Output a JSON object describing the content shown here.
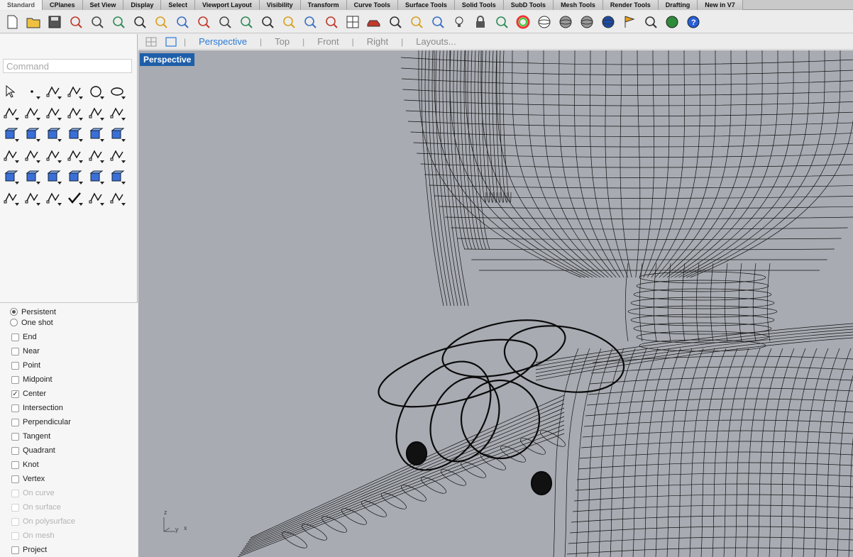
{
  "tabs": [
    "Standard",
    "CPlanes",
    "Set View",
    "Display",
    "Select",
    "Viewport Layout",
    "Visibility",
    "Transform",
    "Curve Tools",
    "Surface Tools",
    "Solid Tools",
    "SubD Tools",
    "Mesh Tools",
    "Render Tools",
    "Drafting",
    "New in V7"
  ],
  "active_tab": "Standard",
  "command": {
    "placeholder": "Command",
    "value": ""
  },
  "viewport_tabs": [
    "Perspective",
    "Top",
    "Front",
    "Right",
    "Layouts..."
  ],
  "active_viewport": "Perspective",
  "viewport_label": "Perspective",
  "snap_mode": {
    "persistent": "Persistent",
    "one_shot": "One shot",
    "selected": "persistent"
  },
  "osnaps": [
    {
      "label": "End",
      "checked": false,
      "enabled": true
    },
    {
      "label": "Near",
      "checked": false,
      "enabled": true
    },
    {
      "label": "Point",
      "checked": false,
      "enabled": true
    },
    {
      "label": "Midpoint",
      "checked": false,
      "enabled": true
    },
    {
      "label": "Center",
      "checked": true,
      "enabled": true
    },
    {
      "label": "Intersection",
      "checked": false,
      "enabled": true
    },
    {
      "label": "Perpendicular",
      "checked": false,
      "enabled": true
    },
    {
      "label": "Tangent",
      "checked": false,
      "enabled": true
    },
    {
      "label": "Quadrant",
      "checked": false,
      "enabled": true
    },
    {
      "label": "Knot",
      "checked": false,
      "enabled": true
    },
    {
      "label": "Vertex",
      "checked": false,
      "enabled": true
    },
    {
      "label": "On curve",
      "checked": false,
      "enabled": false
    },
    {
      "label": "On surface",
      "checked": false,
      "enabled": false
    },
    {
      "label": "On polysurface",
      "checked": false,
      "enabled": false
    },
    {
      "label": "On mesh",
      "checked": false,
      "enabled": false
    },
    {
      "label": "Project",
      "checked": false,
      "enabled": true
    }
  ],
  "axis_labels": {
    "z": "z",
    "y": "y",
    "x": "x"
  },
  "toolbar_icons": [
    "new-file-icon",
    "open-folder-icon",
    "save-icon",
    "print-icon",
    "import-icon",
    "cut-icon",
    "copy-icon",
    "paste-icon",
    "undo-icon",
    "pan-hand-icon",
    "rotate-view-icon",
    "zoom-window-icon",
    "zoom-extents-icon",
    "zoom-selected-icon",
    "zoom-dynamic-icon",
    "undo-view-icon",
    "four-viewports-icon",
    "car-icon",
    "grid-plane-icon",
    "cplane-icon",
    "select-points-icon",
    "light-bulb-icon",
    "lock-icon",
    "layer-icon",
    "color-wheel-icon",
    "wireframe-sphere-icon",
    "shaded-sphere-icon",
    "rendered-sphere-icon",
    "material-sphere-icon",
    "flag-icon",
    "dimension-icon",
    "globe-icon",
    "help-icon"
  ],
  "left_tools": [
    "select-arrow-icon",
    "point-icon",
    "polyline-icon",
    "curve-icon",
    "circle-icon",
    "ellipse-icon",
    "arc-icon",
    "rectangle-icon",
    "polygon-icon",
    "fillet-curve-icon",
    "surface-from-points-icon",
    "extrude-surface-icon",
    "box-icon",
    "sphere-icon",
    "cylinder-icon",
    "plane-surface-icon",
    "solid-tools-icon",
    "explode-icon",
    "extend-icon",
    "offset-icon",
    "boolean-union-icon",
    "boolean-diff-icon",
    "fillet-edge-icon",
    "blend-icon",
    "text-icon",
    "scale-icon",
    "array-icon",
    "edit-points-icon",
    "solid-edit-icon",
    "dimension-tool-icon",
    "grid-array-icon",
    "align-icon",
    "box-edit-icon",
    "check-icon",
    "mesh-icon",
    "render-cone-icon"
  ]
}
